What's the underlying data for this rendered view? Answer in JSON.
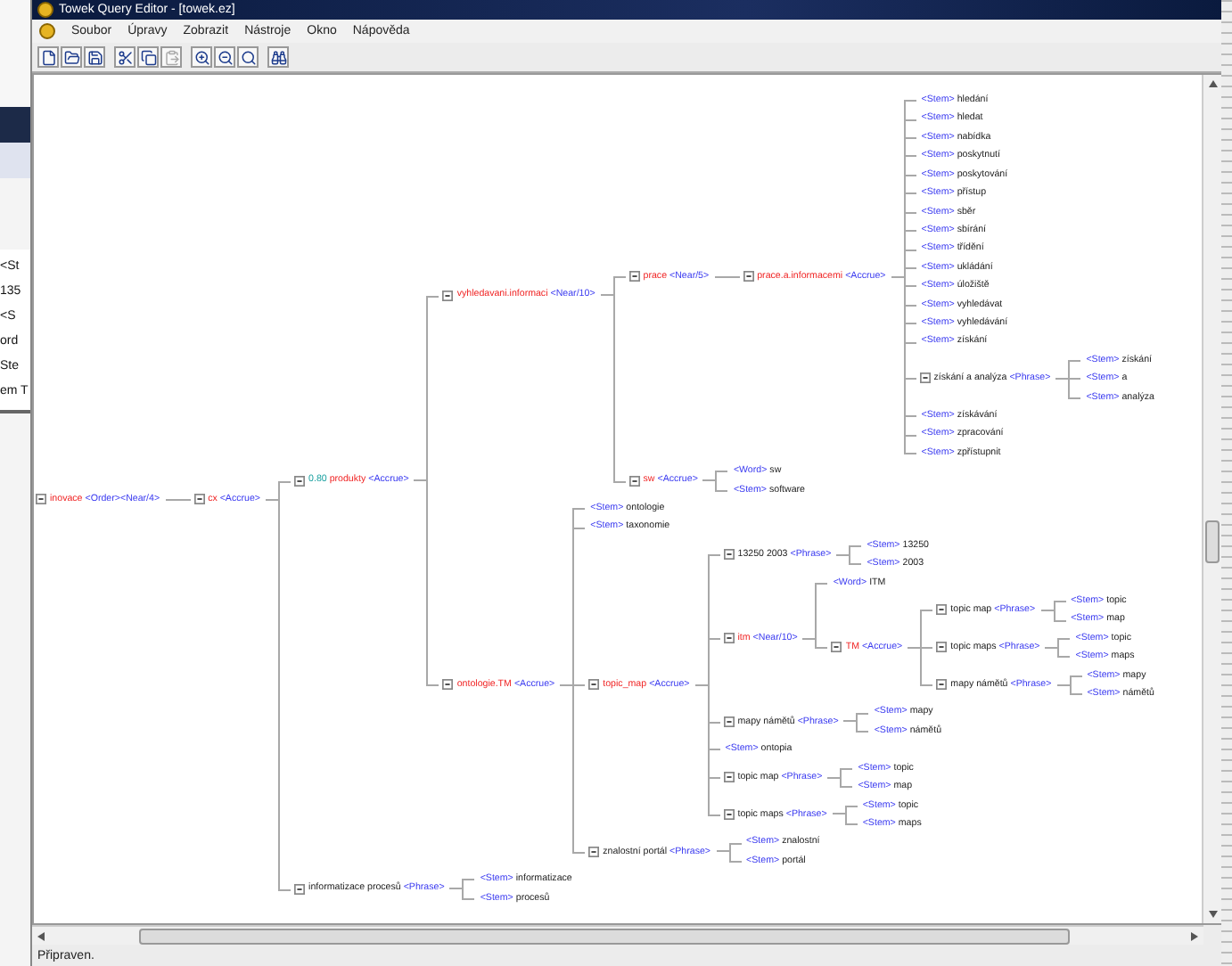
{
  "background_window": {
    "lines": [
      "<St",
      "135",
      "<S",
      "ord",
      "Ste",
      "em T"
    ]
  },
  "window": {
    "title": "Towek Query Editor - [towek.ez]"
  },
  "menu": [
    "Soubor",
    "Úpravy",
    "Zobrazit",
    "Nástroje",
    "Okno",
    "Nápověda"
  ],
  "toolbar": [
    {
      "kind": "new",
      "disabled": false
    },
    {
      "kind": "open",
      "disabled": false
    },
    {
      "kind": "save",
      "disabled": false
    },
    {
      "kind": "cut",
      "disabled": false
    },
    {
      "kind": "copy",
      "disabled": false
    },
    {
      "kind": "paste",
      "disabled": true
    },
    {
      "kind": "zoom-in",
      "disabled": false
    },
    {
      "kind": "zoom-out",
      "disabled": false
    },
    {
      "kind": "zoom-fit",
      "disabled": false
    },
    {
      "kind": "find",
      "disabled": false
    }
  ],
  "tree": {
    "kind": "operator",
    "label": "inovace",
    "tag": "<Order><Near/4>",
    "expanded": true,
    "children": [
      {
        "kind": "operator",
        "label": "cx",
        "tag": "<Accrue>",
        "expanded": true,
        "children": [
          {
            "kind": "operator",
            "score": "0.80",
            "label": "produkty",
            "tag": "<Accrue>",
            "expanded": true,
            "children": [
              {
                "kind": "operator",
                "label": "vyhledavani.informaci",
                "tag": "<Near/10>",
                "expanded": true,
                "children": [
                  {
                    "kind": "operator",
                    "label": "prace",
                    "tag": "<Near/5>",
                    "expanded": true,
                    "children": [
                      {
                        "kind": "operator",
                        "label": "prace.a.informacemi",
                        "tag": "<Accrue>",
                        "expanded": true,
                        "children": [
                          {
                            "kind": "leaf",
                            "tag": "<Stem>",
                            "label": "hledání"
                          },
                          {
                            "kind": "leaf",
                            "tag": "<Stem>",
                            "label": "hledat"
                          },
                          {
                            "kind": "leaf",
                            "tag": "<Stem>",
                            "label": "nabídka"
                          },
                          {
                            "kind": "leaf",
                            "tag": "<Stem>",
                            "label": "poskytnutí"
                          },
                          {
                            "kind": "leaf",
                            "tag": "<Stem>",
                            "label": "poskytování"
                          },
                          {
                            "kind": "leaf",
                            "tag": "<Stem>",
                            "label": "přístup"
                          },
                          {
                            "kind": "leaf",
                            "tag": "<Stem>",
                            "label": "sběr"
                          },
                          {
                            "kind": "leaf",
                            "tag": "<Stem>",
                            "label": "sbírání"
                          },
                          {
                            "kind": "leaf",
                            "tag": "<Stem>",
                            "label": "třídění"
                          },
                          {
                            "kind": "leaf",
                            "tag": "<Stem>",
                            "label": "ukládání"
                          },
                          {
                            "kind": "leaf",
                            "tag": "<Stem>",
                            "label": "úložiště"
                          },
                          {
                            "kind": "leaf",
                            "tag": "<Stem>",
                            "label": "vyhledávat"
                          },
                          {
                            "kind": "leaf",
                            "tag": "<Stem>",
                            "label": "vyhledávání"
                          },
                          {
                            "kind": "leaf",
                            "tag": "<Stem>",
                            "label": "získání"
                          },
                          {
                            "kind": "phrase",
                            "label": "získání a analýza",
                            "tag": "<Phrase>",
                            "expanded": true,
                            "children": [
                              {
                                "kind": "leaf",
                                "tag": "<Stem>",
                                "label": "získání"
                              },
                              {
                                "kind": "leaf",
                                "tag": "<Stem>",
                                "label": "a"
                              },
                              {
                                "kind": "leaf",
                                "tag": "<Stem>",
                                "label": "analýza"
                              }
                            ]
                          },
                          {
                            "kind": "leaf",
                            "tag": "<Stem>",
                            "label": "získávání"
                          },
                          {
                            "kind": "leaf",
                            "tag": "<Stem>",
                            "label": "zpracování"
                          },
                          {
                            "kind": "leaf",
                            "tag": "<Stem>",
                            "label": "zpřístupnit"
                          }
                        ]
                      }
                    ]
                  },
                  {
                    "kind": "operator",
                    "label": "sw",
                    "tag": "<Accrue>",
                    "expanded": true,
                    "children": [
                      {
                        "kind": "leaf",
                        "tag": "<Word>",
                        "label": "sw"
                      },
                      {
                        "kind": "leaf",
                        "tag": "<Stem>",
                        "label": "software"
                      }
                    ]
                  }
                ]
              },
              {
                "kind": "operator",
                "label": "ontologie.TM",
                "tag": "<Accrue>",
                "expanded": true,
                "children": [
                  {
                    "kind": "leaf",
                    "tag": "<Stem>",
                    "label": "ontologie"
                  },
                  {
                    "kind": "leaf",
                    "tag": "<Stem>",
                    "label": "taxonomie"
                  },
                  {
                    "kind": "operator",
                    "label": "topic_map",
                    "tag": "<Accrue>",
                    "expanded": true,
                    "children": [
                      {
                        "kind": "phrase",
                        "label": "13250 2003",
                        "tag": "<Phrase>",
                        "expanded": true,
                        "children": [
                          {
                            "kind": "leaf",
                            "tag": "<Stem>",
                            "label": "13250"
                          },
                          {
                            "kind": "leaf",
                            "tag": "<Stem>",
                            "label": "2003"
                          }
                        ]
                      },
                      {
                        "kind": "operator",
                        "label": "itm",
                        "tag": "<Near/10>",
                        "expanded": true,
                        "children": [
                          {
                            "kind": "leaf",
                            "tag": "<Word>",
                            "label": "ITM"
                          },
                          {
                            "kind": "operator",
                            "label": "TM",
                            "tag": "<Accrue>",
                            "expanded": true,
                            "children": [
                              {
                                "kind": "phrase",
                                "label": "topic map",
                                "tag": "<Phrase>",
                                "expanded": true,
                                "children": [
                                  {
                                    "kind": "leaf",
                                    "tag": "<Stem>",
                                    "label": "topic"
                                  },
                                  {
                                    "kind": "leaf",
                                    "tag": "<Stem>",
                                    "label": "map"
                                  }
                                ]
                              },
                              {
                                "kind": "phrase",
                                "label": "topic maps",
                                "tag": "<Phrase>",
                                "expanded": true,
                                "children": [
                                  {
                                    "kind": "leaf",
                                    "tag": "<Stem>",
                                    "label": "topic"
                                  },
                                  {
                                    "kind": "leaf",
                                    "tag": "<Stem>",
                                    "label": "maps"
                                  }
                                ]
                              },
                              {
                                "kind": "phrase",
                                "label": "mapy námětů",
                                "tag": "<Phrase>",
                                "expanded": true,
                                "children": [
                                  {
                                    "kind": "leaf",
                                    "tag": "<Stem>",
                                    "label": "mapy"
                                  },
                                  {
                                    "kind": "leaf",
                                    "tag": "<Stem>",
                                    "label": "námětů"
                                  }
                                ]
                              }
                            ]
                          }
                        ]
                      },
                      {
                        "kind": "phrase",
                        "label": "mapy námětů",
                        "tag": "<Phrase>",
                        "expanded": true,
                        "children": [
                          {
                            "kind": "leaf",
                            "tag": "<Stem>",
                            "label": "mapy"
                          },
                          {
                            "kind": "leaf",
                            "tag": "<Stem>",
                            "label": "námětů"
                          }
                        ]
                      },
                      {
                        "kind": "leaf",
                        "tag": "<Stem>",
                        "label": "ontopia"
                      },
                      {
                        "kind": "phrase",
                        "label": "topic map",
                        "tag": "<Phrase>",
                        "expanded": true,
                        "children": [
                          {
                            "kind": "leaf",
                            "tag": "<Stem>",
                            "label": "topic"
                          },
                          {
                            "kind": "leaf",
                            "tag": "<Stem>",
                            "label": "map"
                          }
                        ]
                      },
                      {
                        "kind": "phrase",
                        "label": "topic maps",
                        "tag": "<Phrase>",
                        "expanded": true,
                        "children": [
                          {
                            "kind": "leaf",
                            "tag": "<Stem>",
                            "label": "topic"
                          },
                          {
                            "kind": "leaf",
                            "tag": "<Stem>",
                            "label": "maps"
                          }
                        ]
                      }
                    ]
                  },
                  {
                    "kind": "phrase",
                    "label": "znalostní portál",
                    "tag": "<Phrase>",
                    "expanded": true,
                    "children": [
                      {
                        "kind": "leaf",
                        "tag": "<Stem>",
                        "label": "znalostní"
                      },
                      {
                        "kind": "leaf",
                        "tag": "<Stem>",
                        "label": "portál"
                      }
                    ]
                  }
                ]
              }
            ]
          },
          {
            "kind": "phrase",
            "label": "informatizace procesů",
            "tag": "<Phrase>",
            "expanded": true,
            "children": [
              {
                "kind": "leaf",
                "tag": "<Stem>",
                "label": "informatizace"
              },
              {
                "kind": "leaf",
                "tag": "<Stem>",
                "label": "procesů"
              }
            ]
          }
        ]
      }
    ]
  },
  "status_bar": "Připraven."
}
